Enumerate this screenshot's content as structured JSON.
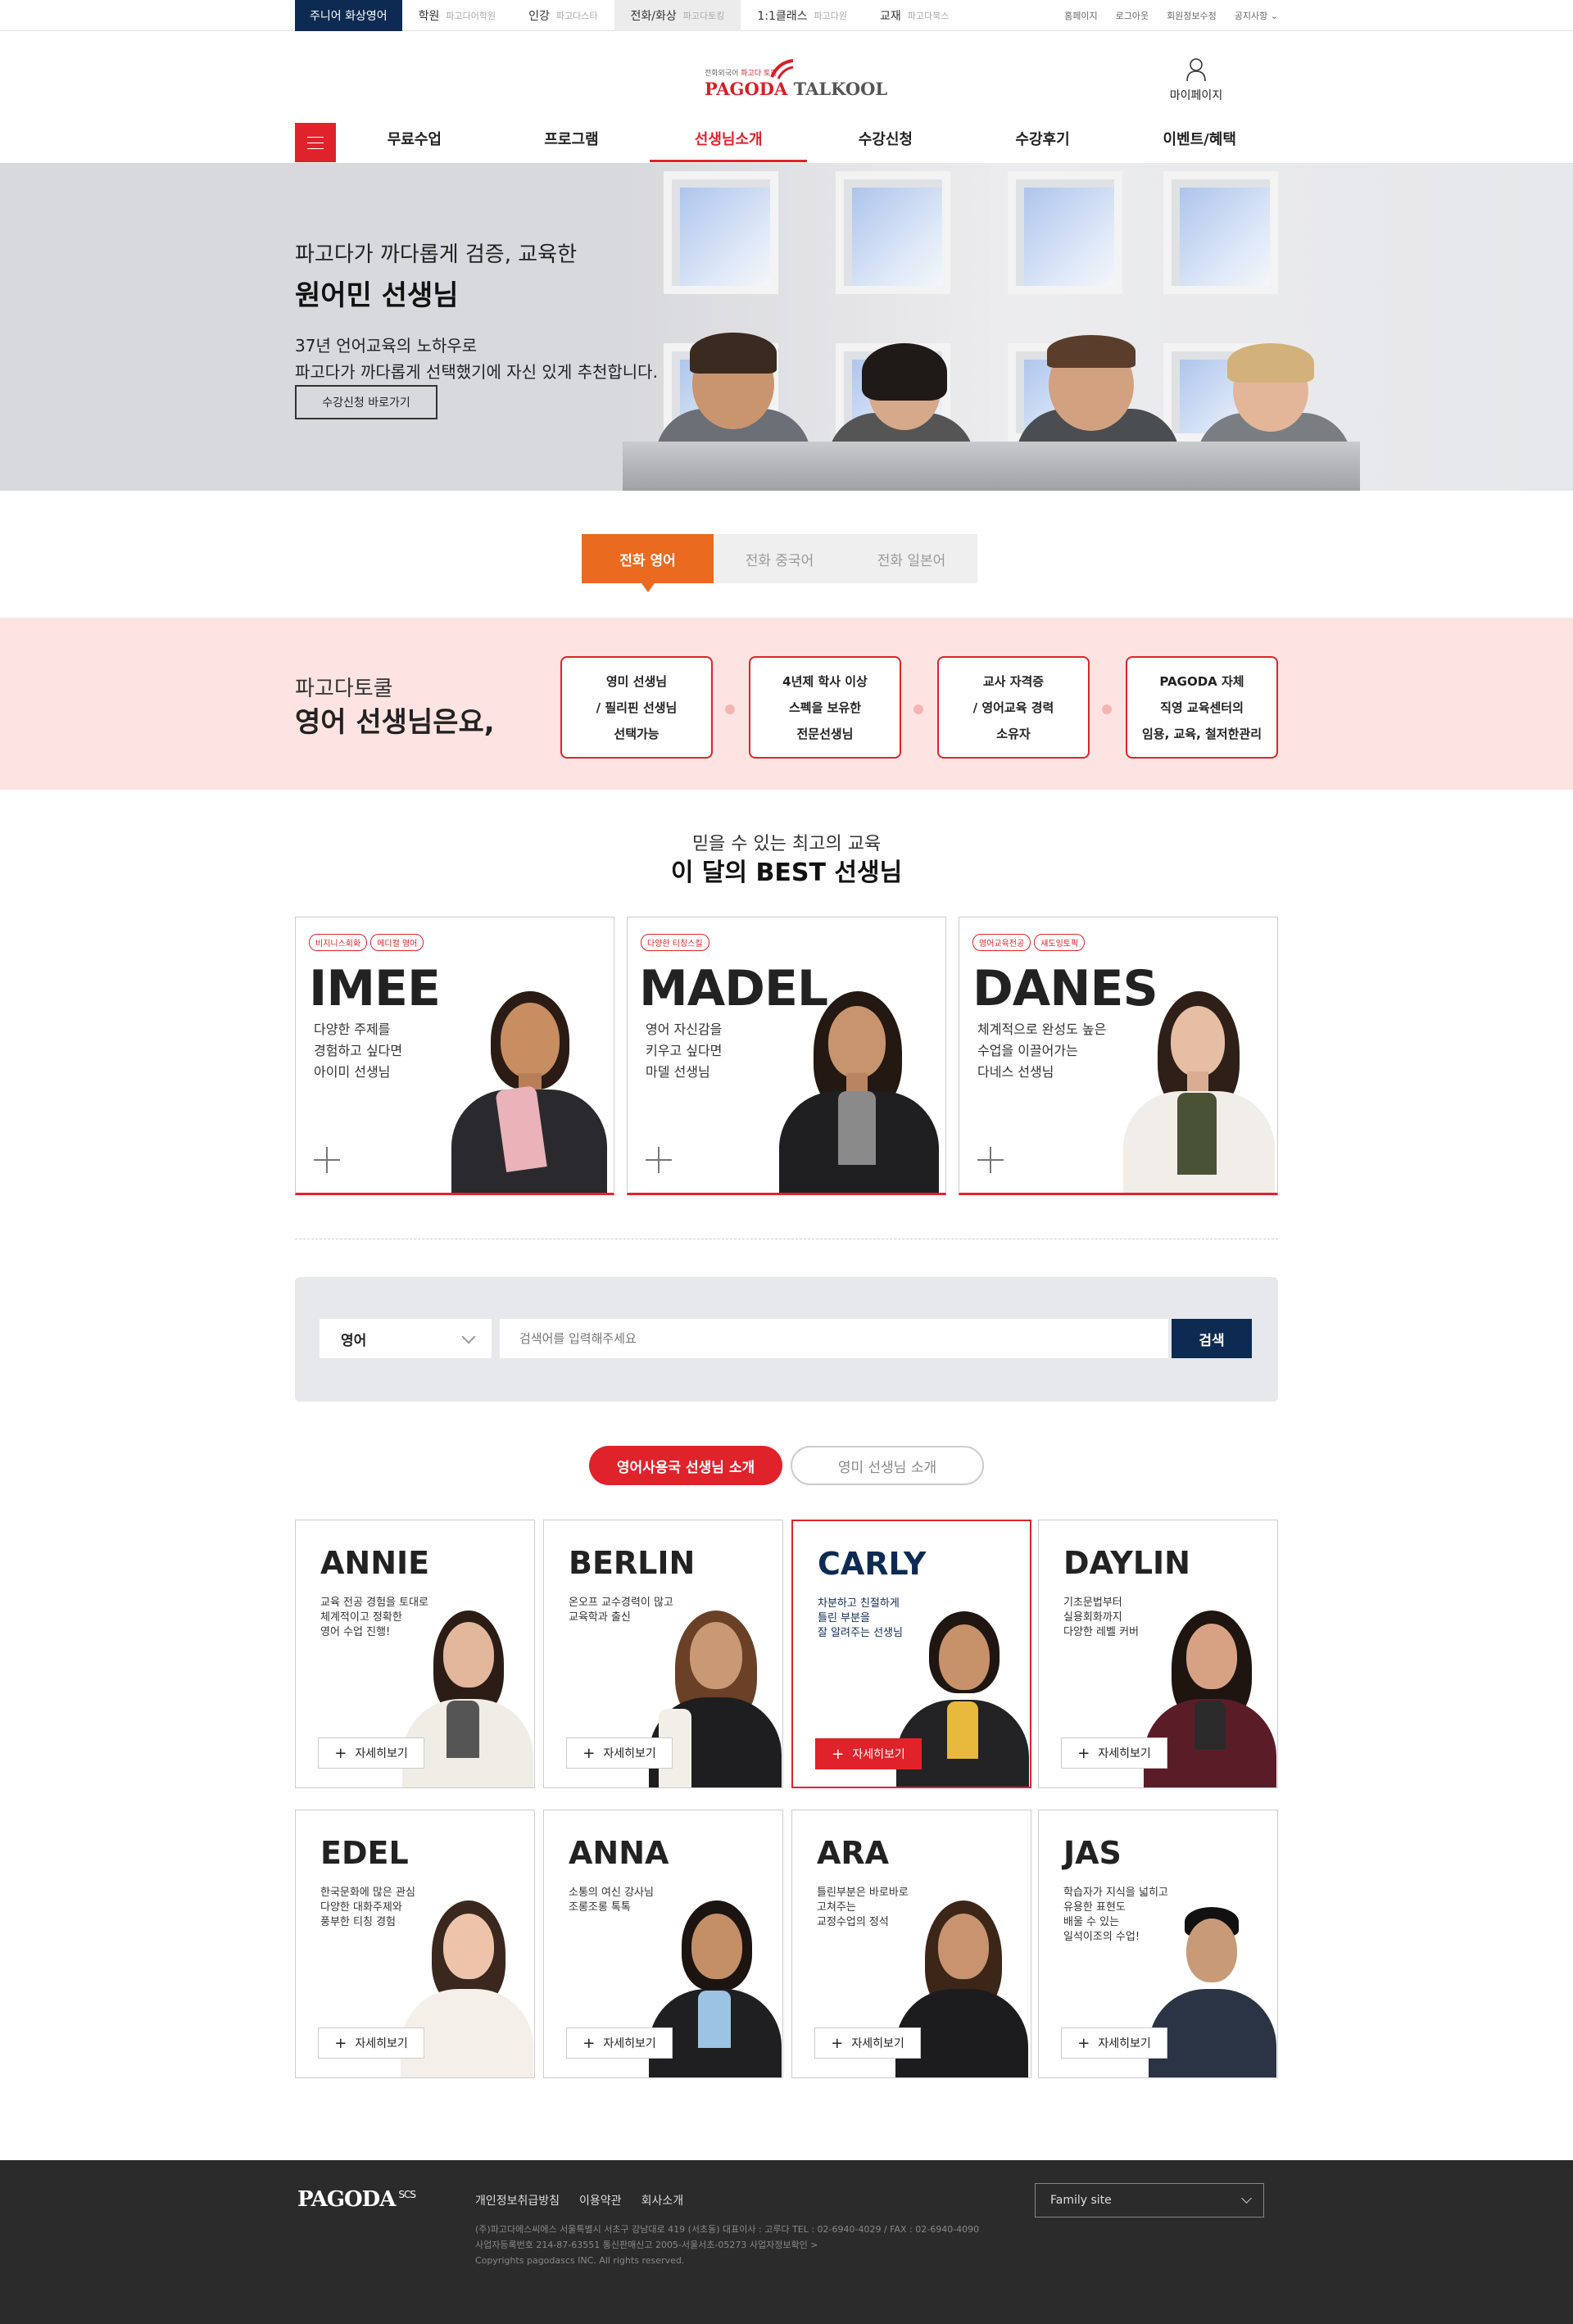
{
  "topbar": {
    "tabs": [
      {
        "label": "주니어 화상영어",
        "sub": ""
      },
      {
        "label": "학원",
        "sub": "파고다어학원"
      },
      {
        "label": "인강",
        "sub": "파고다스타"
      },
      {
        "label": "전화/화상",
        "sub": "파고다토킹"
      },
      {
        "label": "1:1클래스",
        "sub": "파고다원"
      },
      {
        "label": "교재",
        "sub": "파고다북스"
      }
    ],
    "util": [
      "홈페이지",
      "로그아웃",
      "회원정보수정",
      "공지사항"
    ]
  },
  "header": {
    "logo_sub_1": "전화외국어",
    "logo_sub_2": "파고다 토킹",
    "logo_main_1": "PAGODA",
    "logo_main_2": "TALKOOL",
    "mypage_label": "마이페이지"
  },
  "nav": {
    "items": [
      "무료수업",
      "프로그램",
      "선생님소개",
      "수강신청",
      "수강후기",
      "이벤트/혜택"
    ],
    "active_index": 2
  },
  "hero": {
    "line1": "파고다가 까다롭게 검증, 교육한",
    "line2": "원어민 선생님",
    "line3": "37년 언어교육의 노하우로",
    "line4": "파고다가 까다롭게 선택했기에 자신 있게 추천합니다.",
    "button": "수강신청 바로가기"
  },
  "lang_tabs": [
    "전화 영어",
    "전화 중국어",
    "전화 일본어"
  ],
  "intro": {
    "title1": "파고다토쿨",
    "title2": "영어 선생님은요,",
    "features": [
      [
        "영미 선생님",
        "/ 필리핀 선생님",
        "선택가능"
      ],
      [
        "4년제 학사 이상",
        "스펙을 보유한",
        "전문선생님"
      ],
      [
        "교사 자격증",
        "/ 영어교육 경력",
        "소유자"
      ],
      [
        "PAGODA 자체",
        "직영 교육센터의",
        "임용, 교육, 철저한관리"
      ]
    ]
  },
  "best": {
    "subtitle": "믿을 수 있는 최고의 교육",
    "title": "이 달의 BEST 선생님",
    "cards": [
      {
        "tags": [
          "비지니스회화",
          "메디컬 영어"
        ],
        "name": "IMEE",
        "desc": [
          "다양한 주제를",
          "경험하고 싶다면",
          "아이미 선생님"
        ]
      },
      {
        "tags": [
          "다양한 티칭스킬"
        ],
        "name": "MADEL",
        "desc": [
          "영어 자신감을",
          "키우고 싶다면",
          "마델 선생님"
        ]
      },
      {
        "tags": [
          "영어교육전공",
          "섀도잉토픽"
        ],
        "name": "DANES",
        "desc": [
          "체계적으로 완성도 높은",
          "수업을 이끌어가는",
          "다네스 선생님"
        ]
      }
    ]
  },
  "search": {
    "select_value": "영어",
    "placeholder": "검색어를 입력해주세요",
    "button": "검색"
  },
  "filter_tabs": [
    "영어사용국 선생님 소개",
    "영미 선생님 소개"
  ],
  "teachers": [
    {
      "name": "ANNIE",
      "desc": [
        "교육 전공 경험을 토대로",
        "체계적이고 정확한",
        "영어 수업 진행!"
      ]
    },
    {
      "name": "BERLIN",
      "desc": [
        "온오프 교수경력이 많고",
        "교육학과 출신"
      ]
    },
    {
      "name": "CARLY",
      "desc": [
        "차분하고 친절하게",
        "틀린 부분을",
        "잘 알려주는 선생님"
      ]
    },
    {
      "name": "DAYLIN",
      "desc": [
        "기초문법부터",
        "실용회화까지",
        "다양한 레벨 커버"
      ]
    },
    {
      "name": "EDEL",
      "desc": [
        "한국문화에 많은 관심",
        "다양한 대화주제와",
        "풍부한 티칭 경험"
      ]
    },
    {
      "name": "ANNA",
      "desc": [
        "소통의 여신 강사님",
        "조롱조롱 톡톡"
      ]
    },
    {
      "name": "ARA",
      "desc": [
        "틀린부분은 바로바로",
        "고쳐주는",
        "교정수업의 정석"
      ]
    },
    {
      "name": "JAS",
      "desc": [
        "학습자가 지식을 넓히고",
        "유용한 표현도",
        "배울 수 있는",
        "일석이조의 수업!"
      ]
    }
  ],
  "teacher_more_label": "자세히보기",
  "footer": {
    "logo": "PAGODA",
    "logo_sup": "SCS",
    "links": [
      "개인정보취급방침",
      "이용약관",
      "회사소개"
    ],
    "info": [
      "(주)파고다에스씨에스  서울특별시 서초구 강남대로 419 (서초동) 대표이사 : 고루다 TEL : 02-6940-4029 / FAX : 02-6940-4090",
      "사업자등록번호 214-87-63551 통신판매신고 2005-서울서초-05273 사업자정보확인 >",
      "Copyrights pagodascs INC. All rights reserved."
    ],
    "family_site": "Family site"
  }
}
